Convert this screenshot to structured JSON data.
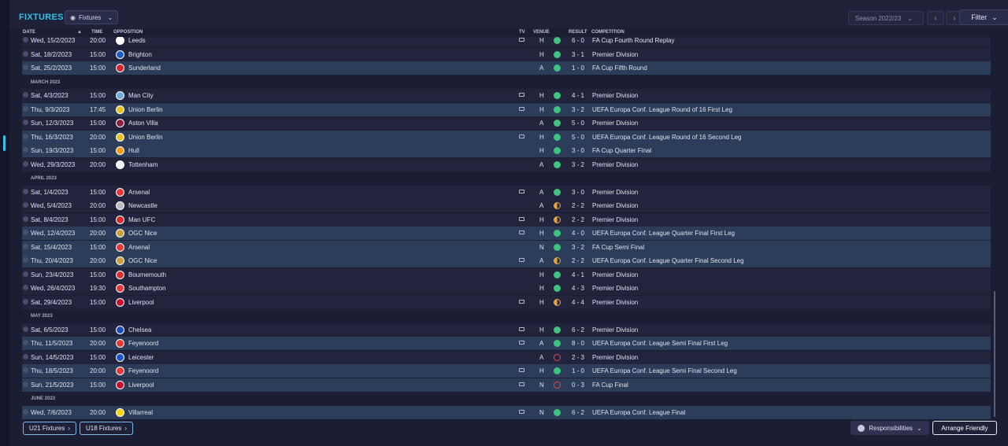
{
  "header": {
    "title": "FIXTURES",
    "view_label": "Fixtures",
    "season": "Season 2022/23",
    "filter_label": "Filter"
  },
  "columns": {
    "date": "DATE",
    "time": "TIME",
    "opposition": "OPPOSITION",
    "tv": "TV",
    "venue": "VENUE",
    "result": "RESULT",
    "competition": "COMPETITION"
  },
  "items": [
    {
      "kind": "match",
      "date": "Wed, 15/2/2023",
      "time": "20:00",
      "opp": "Leeds",
      "crest": "#ffffff",
      "tv": true,
      "venue": "H",
      "outcome": "win",
      "score": "6 - 0",
      "comp": "FA Cup Fourth Round Replay",
      "hl": false
    },
    {
      "kind": "match",
      "date": "Sat, 18/2/2023",
      "time": "15:00",
      "opp": "Brighton",
      "crest": "#1f5bc4",
      "tv": false,
      "venue": "H",
      "outcome": "win",
      "score": "3 - 1",
      "comp": "Premier Division",
      "hl": false
    },
    {
      "kind": "match",
      "date": "Sat, 25/2/2023",
      "time": "15:00",
      "opp": "Sunderland",
      "crest": "#d3272c",
      "tv": false,
      "venue": "A",
      "outcome": "win",
      "score": "1 - 0",
      "comp": "FA Cup Fifth Round",
      "hl": true
    },
    {
      "kind": "month",
      "label": "MARCH 2023"
    },
    {
      "kind": "match",
      "date": "Sat, 4/3/2023",
      "time": "15:00",
      "opp": "Man City",
      "crest": "#6cabdd",
      "tv": true,
      "venue": "H",
      "outcome": "win",
      "score": "4 - 1",
      "comp": "Premier Division",
      "hl": false
    },
    {
      "kind": "match",
      "date": "Thu, 9/3/2023",
      "time": "17:45",
      "opp": "Union Berlin",
      "crest": "#e8c22a",
      "tv": true,
      "venue": "H",
      "outcome": "win",
      "score": "3 - 2",
      "comp": "UEFA Europa Conf. League Round of 16  First Leg",
      "hl": true
    },
    {
      "kind": "match",
      "date": "Sun, 12/3/2023",
      "time": "15:00",
      "opp": "Aston Villa",
      "crest": "#8d1f3f",
      "tv": false,
      "venue": "A",
      "outcome": "win",
      "score": "5 - 0",
      "comp": "Premier Division",
      "hl": false
    },
    {
      "kind": "match",
      "date": "Thu, 16/3/2023",
      "time": "20:00",
      "opp": "Union Berlin",
      "crest": "#e8c22a",
      "tv": true,
      "venue": "H",
      "outcome": "win",
      "score": "5 - 0",
      "comp": "UEFA Europa Conf. League Round of 16  Second Leg",
      "hl": true
    },
    {
      "kind": "match",
      "date": "Sun, 19/3/2023",
      "time": "15:00",
      "opp": "Hull",
      "crest": "#f29b1d",
      "tv": false,
      "venue": "H",
      "outcome": "win",
      "score": "3 - 0",
      "comp": "FA Cup Quarter Final",
      "hl": true
    },
    {
      "kind": "match",
      "date": "Wed, 29/3/2023",
      "time": "20:00",
      "opp": "Tottenham",
      "crest": "#eef2f7",
      "tv": false,
      "venue": "A",
      "outcome": "win",
      "score": "3 - 2",
      "comp": "Premier Division",
      "hl": false
    },
    {
      "kind": "month",
      "label": "APRIL 2023"
    },
    {
      "kind": "match",
      "date": "Sat, 1/4/2023",
      "time": "15:00",
      "opp": "Arsenal",
      "crest": "#e23a3a",
      "tv": true,
      "venue": "A",
      "outcome": "win",
      "score": "3 - 0",
      "comp": "Premier Division",
      "hl": false
    },
    {
      "kind": "match",
      "date": "Wed, 5/4/2023",
      "time": "20:00",
      "opp": "Newcastle",
      "crest": "#bdbdbd",
      "tv": false,
      "venue": "A",
      "outcome": "draw",
      "score": "2 - 2",
      "comp": "Premier Division",
      "hl": false
    },
    {
      "kind": "match",
      "date": "Sat, 8/4/2023",
      "time": "15:00",
      "opp": "Man UFC",
      "crest": "#d52b2b",
      "tv": true,
      "venue": "H",
      "outcome": "draw",
      "score": "2 - 2",
      "comp": "Premier Division",
      "hl": false
    },
    {
      "kind": "match",
      "date": "Wed, 12/4/2023",
      "time": "20:00",
      "opp": "OGC Nice",
      "crest": "#c8a040",
      "tv": true,
      "venue": "H",
      "outcome": "win",
      "score": "4 - 0",
      "comp": "UEFA Europa Conf. League Quarter Final First Leg",
      "hl": true
    },
    {
      "kind": "match",
      "date": "Sat, 15/4/2023",
      "time": "15:00",
      "opp": "Arsenal",
      "crest": "#e23a3a",
      "tv": false,
      "venue": "N",
      "outcome": "win",
      "score": "3 - 2",
      "comp": "FA Cup Semi Final",
      "hl": true
    },
    {
      "kind": "match",
      "date": "Thu, 20/4/2023",
      "time": "20:00",
      "opp": "OGC Nice",
      "crest": "#c8a040",
      "tv": true,
      "venue": "A",
      "outcome": "draw",
      "score": "2 - 2",
      "comp": "UEFA Europa Conf. League Quarter Final Second Leg",
      "hl": true
    },
    {
      "kind": "match",
      "date": "Sun, 23/4/2023",
      "time": "15:00",
      "opp": "Bournemouth",
      "crest": "#d83030",
      "tv": false,
      "venue": "H",
      "outcome": "win",
      "score": "4 - 1",
      "comp": "Premier Division",
      "hl": false
    },
    {
      "kind": "match",
      "date": "Wed, 26/4/2023",
      "time": "19:30",
      "opp": "Southampton",
      "crest": "#e23a3a",
      "tv": false,
      "venue": "H",
      "outcome": "win",
      "score": "4 - 3",
      "comp": "Premier Division",
      "hl": false
    },
    {
      "kind": "match",
      "date": "Sat, 29/4/2023",
      "time": "15:00",
      "opp": "Liverpool",
      "crest": "#c8102e",
      "tv": true,
      "venue": "H",
      "outcome": "draw",
      "score": "4 - 4",
      "comp": "Premier Division",
      "hl": false
    },
    {
      "kind": "month",
      "label": "MAY 2023"
    },
    {
      "kind": "match",
      "date": "Sat, 6/5/2023",
      "time": "15:00",
      "opp": "Chelsea",
      "crest": "#1f4bb8",
      "tv": true,
      "venue": "H",
      "outcome": "win",
      "score": "6 - 2",
      "comp": "Premier Division",
      "hl": false
    },
    {
      "kind": "match",
      "date": "Thu, 11/5/2023",
      "time": "20:00",
      "opp": "Feyenoord",
      "crest": "#e03a3a",
      "tv": true,
      "venue": "A",
      "outcome": "win",
      "score": "8 - 0",
      "comp": "UEFA Europa Conf. League Semi Final First Leg",
      "hl": true
    },
    {
      "kind": "match",
      "date": "Sun, 14/5/2023",
      "time": "15:00",
      "opp": "Leicester",
      "crest": "#1b55c8",
      "tv": false,
      "venue": "A",
      "outcome": "loss",
      "score": "2 - 3",
      "comp": "Premier Division",
      "hl": false
    },
    {
      "kind": "match",
      "date": "Thu, 18/5/2023",
      "time": "20:00",
      "opp": "Feyenoord",
      "crest": "#e03a3a",
      "tv": true,
      "venue": "H",
      "outcome": "win",
      "score": "1 - 0",
      "comp": "UEFA Europa Conf. League Semi Final Second Leg",
      "hl": true
    },
    {
      "kind": "match",
      "date": "Sun, 21/5/2023",
      "time": "15:00",
      "opp": "Liverpool",
      "crest": "#c8102e",
      "tv": true,
      "venue": "N",
      "outcome": "loss",
      "score": "0 - 3",
      "comp": "FA Cup Final",
      "hl": true
    },
    {
      "kind": "month",
      "label": "JUNE 2023"
    },
    {
      "kind": "match",
      "date": "Wed, 7/6/2023",
      "time": "20:00",
      "opp": "Villarreal",
      "crest": "#f5d40f",
      "tv": true,
      "venue": "N",
      "outcome": "win",
      "score": "6 - 2",
      "comp": "UEFA Europa Conf. League Final",
      "hl": true
    }
  ],
  "footer": {
    "u21": "U21 Fixtures",
    "u18": "U18 Fixtures",
    "responsibilities": "Responsibilities",
    "friendly": "Arrange Friendly"
  },
  "colors": {
    "accent": "#31c4e8",
    "win": "#3dc47e",
    "draw": "#e8a43a",
    "loss": "#e0464d"
  }
}
